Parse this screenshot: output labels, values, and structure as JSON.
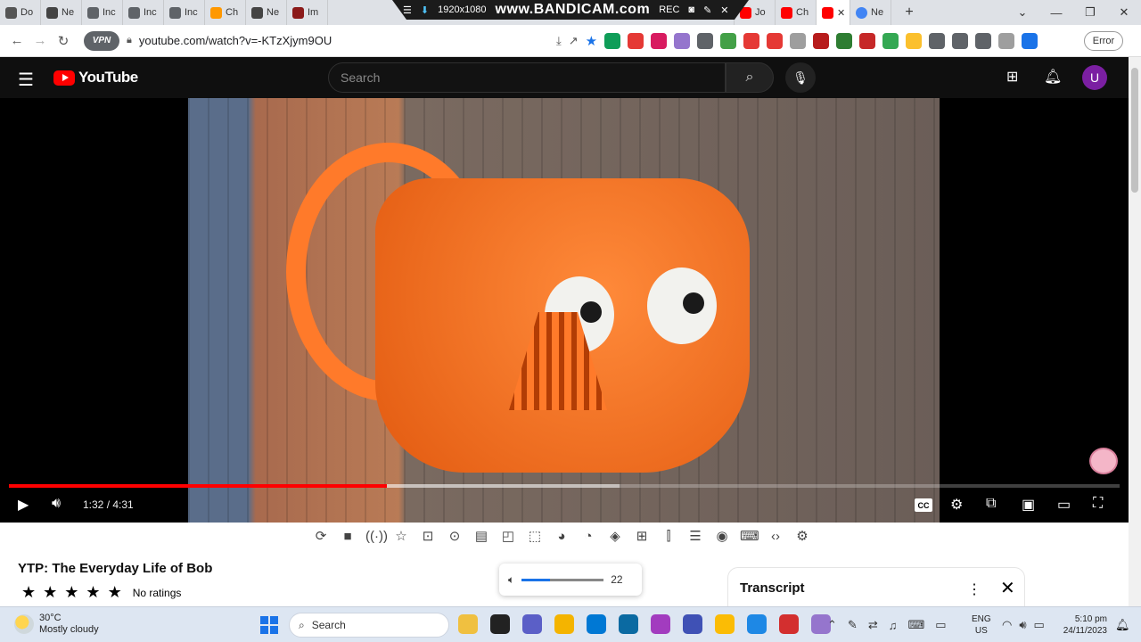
{
  "browser": {
    "tabs": [
      {
        "label": "Do",
        "color": "#555555"
      },
      {
        "label": "Ne",
        "color": "#444444"
      },
      {
        "label": "Inc",
        "color": "#5f6368"
      },
      {
        "label": "Inc",
        "color": "#5f6368"
      },
      {
        "label": "Inc",
        "color": "#5f6368"
      },
      {
        "label": "Ch",
        "color": "#ff9800"
      },
      {
        "label": "Ne",
        "color": "#444444"
      },
      {
        "label": "Im",
        "color": "#8b1a1a"
      }
    ],
    "tabs_right": [
      {
        "label": "Ne",
        "color": "#4285f4"
      },
      {
        "label": "Jo",
        "color": "#ff0000"
      },
      {
        "label": "Ch",
        "color": "#ff0000"
      }
    ],
    "active_tab": {
      "close": "✕",
      "color": "#ff0000"
    },
    "last_tab": {
      "label": "Ne",
      "color": "#4285f4"
    },
    "new_tab": "+",
    "url": "youtube.com/watch?v=-KTzXjym9OU",
    "vpn_label": "VPN",
    "error_button": "Error",
    "window_controls": {
      "minimize": "—",
      "maximize": "❐",
      "close": "✕"
    }
  },
  "bandicam": {
    "resolution": "1920x1080",
    "brand": "www.BANDICAM.com",
    "rec": "REC"
  },
  "extensions": [
    "#0f9d58",
    "#e53935",
    "#d81b60",
    "#9575cd",
    "#5f6368",
    "#43a047",
    "#e53935",
    "#e53935",
    "#9e9e9e",
    "#b71c1c",
    "#2e7d32",
    "#c62828",
    "#34a853",
    "#fbc02d",
    "#5f6368",
    "#5f6368",
    "#5f6368",
    "#9e9e9e",
    "#1a73e8"
  ],
  "youtube": {
    "logo_text": "YouTube",
    "search_placeholder": "Search",
    "avatar_letter": "U",
    "player": {
      "current_time": "1:32",
      "duration": "4:31",
      "time_display": "1:32 / 4:31",
      "played_fraction": 0.34,
      "buffered_fraction": 0.55,
      "cc_label": "CC"
    },
    "video_title": "YTP: The Everyday Life of Bob",
    "rating_stars": [
      "★",
      "★",
      "★",
      "★",
      "★"
    ],
    "rating_text": "No ratings",
    "volume_value": "22",
    "volume_fraction": 0.35,
    "transcript_title": "Transcript"
  },
  "player_toolbar_icons": [
    "loop-icon",
    "stop-icon",
    "broadcast-icon",
    "star-icon",
    "screen-record-icon",
    "cinema-icon",
    "film-icon",
    "frame-icon",
    "selection-icon",
    "palette-icon",
    "speed-icon",
    "filter-icon",
    "add-icon",
    "split-icon",
    "menu-icon",
    "camera-icon",
    "keyboard-icon",
    "code-icon",
    "gear-icon"
  ],
  "taskbar": {
    "temperature": "30°C",
    "weather": "Mostly cloudy",
    "search_label": "Search",
    "language": "ENG",
    "region": "US",
    "time": "5:10 pm",
    "date": "24/11/2023",
    "apps": [
      "#f0c040",
      "#222222",
      "#5b5fc7",
      "#f4b400",
      "#0078d4",
      "#0b6aa2",
      "#a23cbf",
      "#3f51b5",
      "#fbbc05",
      "#1e88e5",
      "#d32f2f",
      "#9575cd"
    ]
  }
}
